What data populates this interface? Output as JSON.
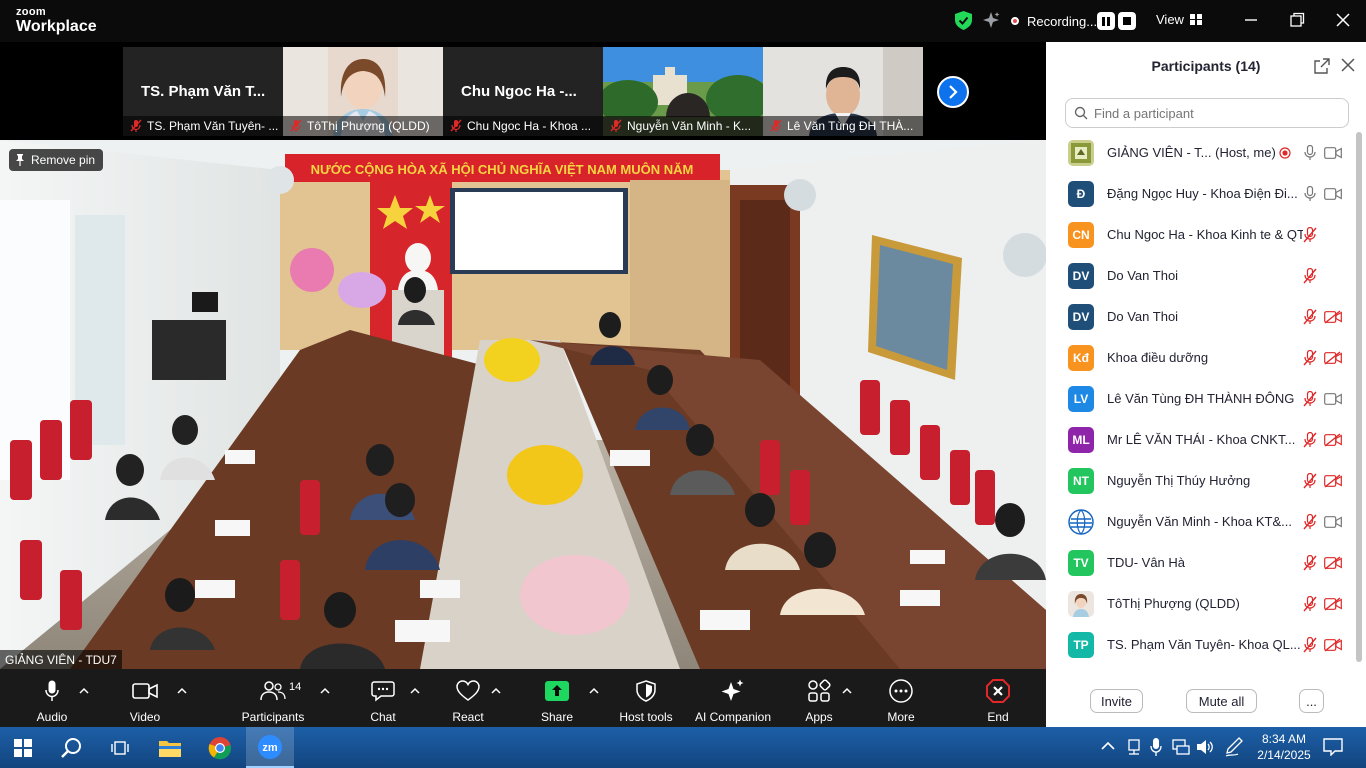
{
  "titlebar": {
    "logo_top": "zoom",
    "logo_bottom": "Workplace",
    "recording_label": "Recording...",
    "view_label": "View"
  },
  "thumbnails": [
    {
      "name": "TS. Phạm Văn T...",
      "caption": "TS. Phạm Văn Tuyên- ...",
      "type": "name"
    },
    {
      "name": "",
      "caption": "TôThị Phượng (QLDD)",
      "type": "photo-woman"
    },
    {
      "name": "Chu Ngoc Ha -...",
      "caption": "Chu Ngoc Ha - Khoa ...",
      "type": "name"
    },
    {
      "name": "",
      "caption": "Nguyễn Văn Minh - K...",
      "type": "video-building"
    },
    {
      "name": "",
      "caption": "Lê Văn Tùng ĐH THÀ...",
      "type": "video-man"
    }
  ],
  "main_video": {
    "remove_pin_label": "Remove pin",
    "speaker_label": "GIẢNG VIÊN - TDU7",
    "banner_text": "NƯỚC CỘNG HÒA XÃ HỘI CHỦ NGHĨA VIỆT NAM MUÔN NĂM"
  },
  "toolbar": {
    "audio": "Audio",
    "video": "Video",
    "participants": "Participants",
    "participants_count": "14",
    "chat": "Chat",
    "react": "React",
    "share": "Share",
    "host_tools": "Host tools",
    "ai_companion": "AI Companion",
    "apps": "Apps",
    "more": "More",
    "end": "End"
  },
  "panel": {
    "title": "Participants (14)",
    "search_placeholder": "Find a participant",
    "invite_label": "Invite",
    "mute_all_label": "Mute all",
    "more_label": "...",
    "participants": [
      {
        "initials": "",
        "name": "GIẢNG VIÊN - T...  (Host, me)",
        "color": "#8a9a3a",
        "avatar": "logo",
        "rec": true,
        "mic": "on",
        "cam": "on"
      },
      {
        "initials": "Đ",
        "name": "Đặng Ngọc Huy - Khoa Điện Đi...",
        "color": "#1f4e79",
        "avatar": "initials",
        "rec": false,
        "mic": "on",
        "cam": "on"
      },
      {
        "initials": "CN",
        "name": "Chu Ngoc Ha - Khoa Kinh te & QT...",
        "color": "#f7931e",
        "avatar": "initials",
        "rec": false,
        "mic": "muted",
        "cam": "none"
      },
      {
        "initials": "DV",
        "name": "Do Van Thoi",
        "color": "#1f4e79",
        "avatar": "initials",
        "rec": false,
        "mic": "muted",
        "cam": "none"
      },
      {
        "initials": "DV",
        "name": "Do Van Thoi",
        "color": "#1f4e79",
        "avatar": "initials",
        "rec": false,
        "mic": "muted",
        "cam": "off"
      },
      {
        "initials": "Kđ",
        "name": "Khoa điều dưỡng",
        "color": "#f7931e",
        "avatar": "initials",
        "rec": false,
        "mic": "muted",
        "cam": "off"
      },
      {
        "initials": "LV",
        "name": "Lê Văn Tùng ĐH THÀNH ĐÔNG",
        "color": "#1e88e5",
        "avatar": "initials",
        "rec": false,
        "mic": "muted",
        "cam": "on"
      },
      {
        "initials": "ML",
        "name": "Mr LÊ VĂN THÁI - Khoa CNKT...",
        "color": "#8e24aa",
        "avatar": "initials",
        "rec": false,
        "mic": "muted",
        "cam": "off"
      },
      {
        "initials": "NT",
        "name": "Nguyễn Thị Thúy  Hưởng",
        "color": "#22c55e",
        "avatar": "initials",
        "rec": false,
        "mic": "muted",
        "cam": "off"
      },
      {
        "initials": "",
        "name": "Nguyễn Văn Minh - Khoa KT&...",
        "color": "#1565c0",
        "avatar": "globe",
        "rec": false,
        "mic": "muted",
        "cam": "on"
      },
      {
        "initials": "TV",
        "name": "TDU- Vân Hà",
        "color": "#22c55e",
        "avatar": "initials",
        "rec": false,
        "mic": "muted",
        "cam": "off"
      },
      {
        "initials": "",
        "name": "TôThị Phượng (QLDD)",
        "color": "#f2d2b8",
        "avatar": "photo",
        "rec": false,
        "mic": "muted",
        "cam": "off"
      },
      {
        "initials": "TP",
        "name": "TS. Phạm Văn Tuyên- Khoa QL...",
        "color": "#14b8a6",
        "avatar": "initials",
        "rec": false,
        "mic": "muted",
        "cam": "off"
      }
    ]
  },
  "taskbar": {
    "time": "8:34 AM",
    "date": "2/14/2025"
  }
}
